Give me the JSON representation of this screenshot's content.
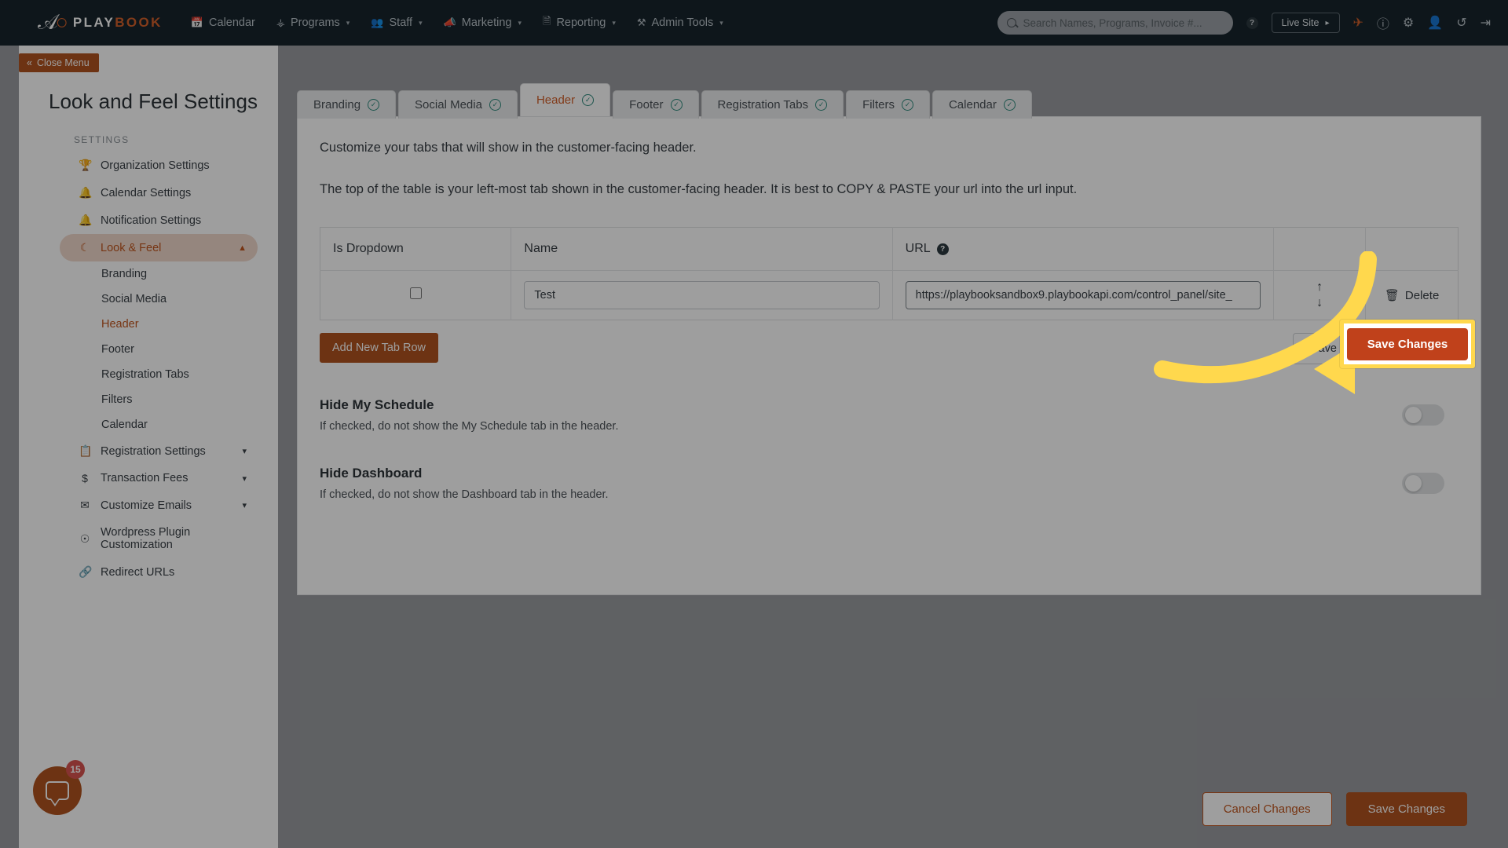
{
  "topnav": {
    "logo_mark": "℘",
    "logo_text_1": "PLAY",
    "logo_text_2": "BOOK",
    "items": [
      {
        "label": "Calendar",
        "icon": "calendar-icon",
        "glyph": "Ὄ5",
        "caret": false
      },
      {
        "label": "Programs",
        "icon": "sitemap-icon",
        "glyph": "⑂",
        "caret": true
      },
      {
        "label": "Staff",
        "icon": "users-icon",
        "glyph": "\u0000",
        "caret": true
      },
      {
        "label": "Marketing",
        "icon": "megaphone-icon",
        "glyph": "\u0000",
        "caret": true
      },
      {
        "label": "Reporting",
        "icon": "document-icon",
        "glyph": "\u0000",
        "caret": true
      },
      {
        "label": "Admin Tools",
        "icon": "tools-icon",
        "glyph": "\u0000",
        "caret": true
      }
    ],
    "search_placeholder": "Search Names, Programs, Invoice #...",
    "help_badge": "?",
    "live_site_label": "Live Site",
    "right_icons": [
      "rocket-icon",
      "help-circle-icon",
      "gear-icon",
      "add-user-icon",
      "history-icon",
      "logout-icon"
    ]
  },
  "sidebar": {
    "close_menu_label": "Close Menu",
    "title": "Look and Feel Settings",
    "section_label": "SETTINGS",
    "items": [
      {
        "label": "Organization Settings",
        "icon": "trophy-icon",
        "active": false,
        "chevron": ""
      },
      {
        "label": "Calendar Settings",
        "icon": "bell-icon",
        "active": false,
        "chevron": ""
      },
      {
        "label": "Notification Settings",
        "icon": "bell-icon",
        "active": false,
        "chevron": ""
      },
      {
        "label": "Look & Feel",
        "icon": "balloon-icon",
        "active": true,
        "chevron": "⌃"
      }
    ],
    "subitems": [
      {
        "label": "Branding",
        "active": false
      },
      {
        "label": "Social Media",
        "active": false
      },
      {
        "label": "Header",
        "active": true
      },
      {
        "label": "Footer",
        "active": false
      },
      {
        "label": "Registration Tabs",
        "active": false
      },
      {
        "label": "Filters",
        "active": false
      },
      {
        "label": "Calendar",
        "active": false
      }
    ],
    "items_bottom": [
      {
        "label": "Registration Settings",
        "icon": "form-icon",
        "chevron": "⌄"
      },
      {
        "label": "Transaction Fees",
        "icon": "dollar-icon",
        "chevron": "⌄"
      },
      {
        "label": "Customize Emails",
        "icon": "envelope-icon",
        "chevron": "⌄"
      },
      {
        "label": "Wordpress Plugin Customization",
        "icon": "globe-icon",
        "chevron": ""
      },
      {
        "label": "Redirect URLs",
        "icon": "link-icon",
        "chevron": ""
      }
    ]
  },
  "tabs": [
    {
      "label": "Branding",
      "checked": true,
      "active": false
    },
    {
      "label": "Social Media",
      "checked": true,
      "active": false
    },
    {
      "label": "Header",
      "checked": true,
      "active": true
    },
    {
      "label": "Footer",
      "checked": true,
      "active": false
    },
    {
      "label": "Registration Tabs",
      "checked": true,
      "active": false
    },
    {
      "label": "Filters",
      "checked": true,
      "active": false
    },
    {
      "label": "Calendar",
      "checked": true,
      "active": false
    }
  ],
  "panel": {
    "lead": "Customize your tabs that will show in the customer-facing header.",
    "lead2": "The top of the table is your left-most tab shown in the customer-facing header. It is best to COPY & PASTE your url into the url input.",
    "table": {
      "headers": [
        "Is Dropdown",
        "Name",
        "URL",
        "",
        ""
      ],
      "url_help_badge": "?",
      "rows": [
        {
          "is_dropdown": false,
          "name": "Test",
          "url": "https://playbooksandbox9.playbookapi.com/control_panel/site_",
          "up_arrow": "↑",
          "down_arrow": "↓",
          "delete_label": "Delete"
        }
      ]
    },
    "add_row_label": "Add New Tab Row",
    "inline_save_label": "Save Changes",
    "toggles": [
      {
        "title": "Hide My Schedule",
        "description": "If checked, do not show the My Schedule tab in the header.",
        "on": false
      },
      {
        "title": "Hide Dashboard",
        "description": "If checked, do not show the Dashboard tab in the header.",
        "on": false
      }
    ]
  },
  "footer": {
    "cancel_label": "Cancel Changes",
    "save_label": "Save Changes"
  },
  "chat": {
    "badge_count": "15"
  },
  "annotation": {
    "highlight_button_label": "Save Changes",
    "arrow_color": "#ffd84d",
    "highlight_border_color": "#ffd84d"
  },
  "colors": {
    "brand_orange": "#d2602a",
    "brand_dark": "#17242c",
    "button_orange": "#b0531f",
    "check_green": "#2e8a7d"
  }
}
